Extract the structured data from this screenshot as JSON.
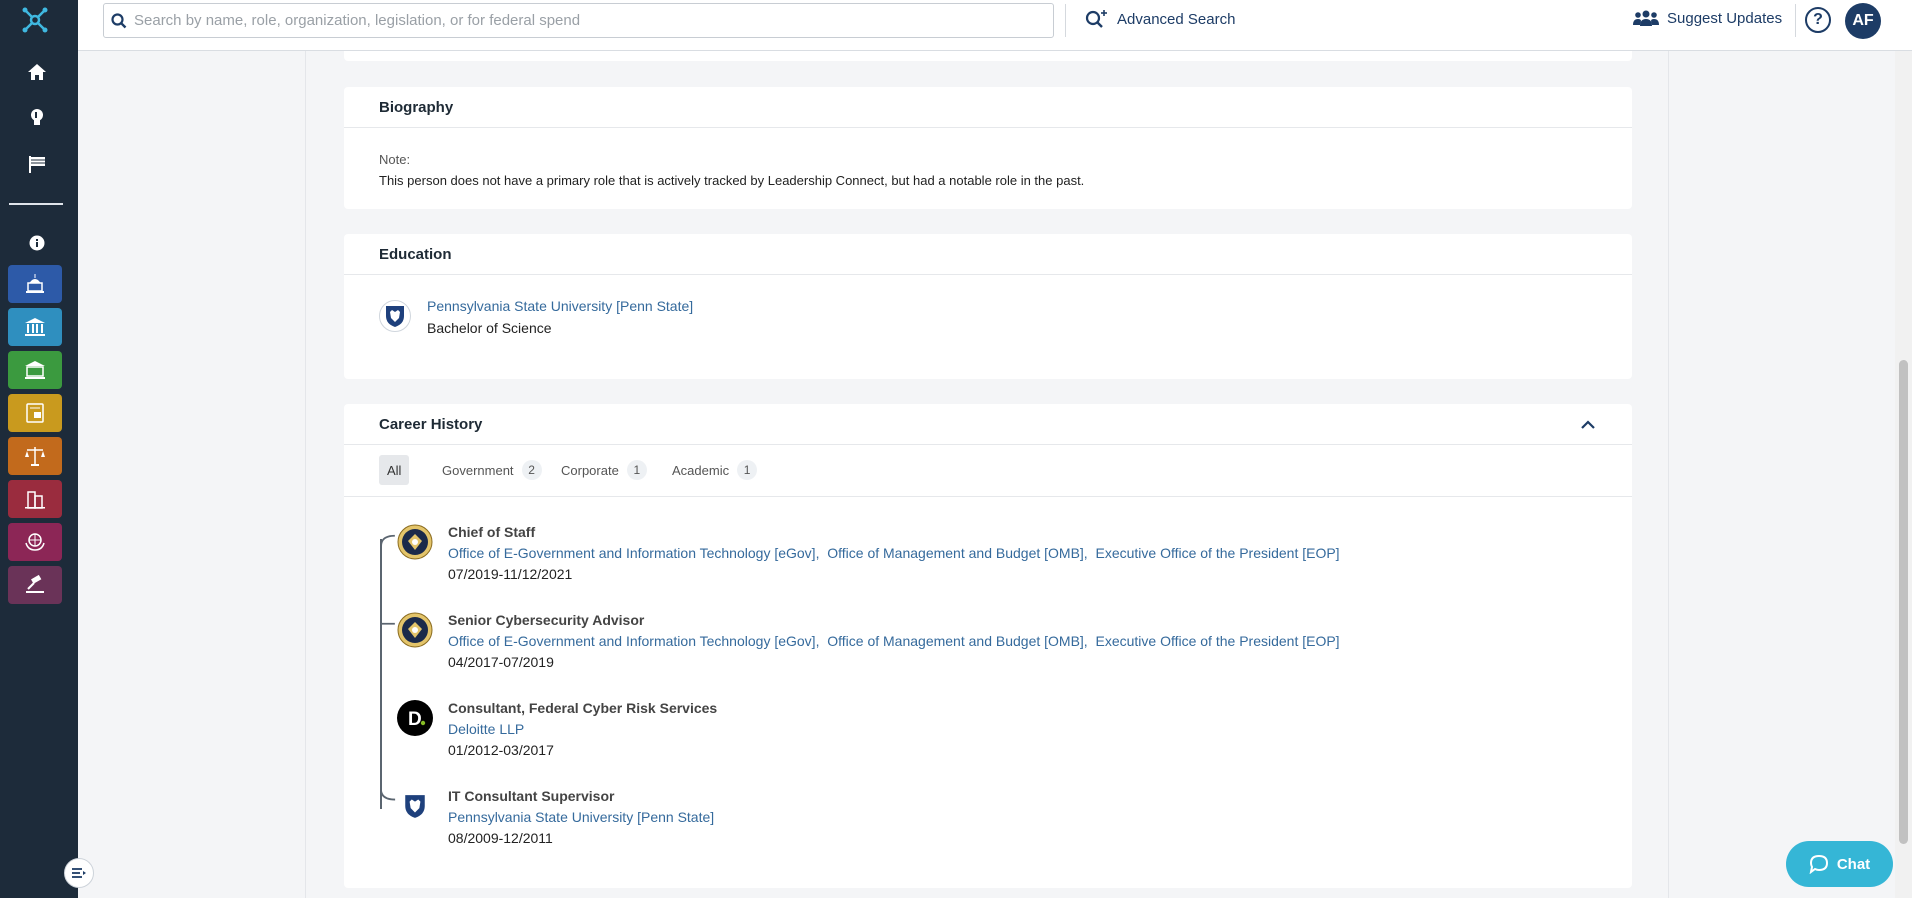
{
  "search": {
    "placeholder": "Search by name, role, organization, legislation, or for federal spend"
  },
  "topbar": {
    "advanced_search": "Advanced Search",
    "suggest_updates": "Suggest Updates",
    "help": "?",
    "avatar_initials": "AF"
  },
  "sidebar": {
    "icons": [
      "logo-icon",
      "home-icon",
      "lightbulb-icon",
      "flag-icon",
      "info-icon"
    ],
    "tiles": [
      {
        "name": "capitol-tile",
        "color": "#2d5aa8"
      },
      {
        "name": "federal-building-tile",
        "color": "#2f8fbf"
      },
      {
        "name": "state-building-tile",
        "color": "#3b9a3f"
      },
      {
        "name": "id-card-tile",
        "color": "#c99a1e"
      },
      {
        "name": "scales-tile",
        "color": "#c26a1c"
      },
      {
        "name": "city-tile",
        "color": "#9a2c3e"
      },
      {
        "name": "globe-hands-tile",
        "color": "#8c2656"
      },
      {
        "name": "gavel-tile",
        "color": "#6a3358"
      }
    ]
  },
  "biography": {
    "title": "Biography",
    "note_label": "Note:",
    "note_text": "This person does not have a primary role that is actively tracked by Leadership Connect, but had a notable role in the past."
  },
  "education": {
    "title": "Education",
    "items": [
      {
        "school": "Pennsylvania State University [Penn State]",
        "degree": "Bachelor of Science"
      }
    ]
  },
  "career": {
    "title": "Career History",
    "tabs": [
      {
        "label": "All",
        "count": ""
      },
      {
        "label": "Government",
        "count": "2"
      },
      {
        "label": "Corporate",
        "count": "1"
      },
      {
        "label": "Academic",
        "count": "1"
      }
    ],
    "jobs": [
      {
        "title": "Chief of Staff",
        "orgs": [
          "Office of E-Government and Information Technology [eGov],",
          "Office of Management and Budget [OMB],",
          "Executive Office of the President [EOP]"
        ],
        "dates": "07/2019-11/12/2021"
      },
      {
        "title": "Senior Cybersecurity Advisor",
        "orgs": [
          "Office of E-Government and Information Technology [eGov],",
          "Office of Management and Budget [OMB],",
          "Executive Office of the President [EOP]"
        ],
        "dates": "04/2017-07/2019"
      },
      {
        "title": "Consultant, Federal Cyber Risk Services",
        "orgs": [
          "Deloitte LLP"
        ],
        "dates": "01/2012-03/2017"
      },
      {
        "title": "IT Consultant Supervisor",
        "orgs": [
          "Pennsylvania State University [Penn State]"
        ],
        "dates": "08/2009-12/2011"
      }
    ]
  },
  "chat": {
    "label": "Chat"
  },
  "colors": {
    "brand": "#1d3c66",
    "link": "#356a9c",
    "sidebar": "#1d2b3a",
    "chat": "#35b6d6"
  }
}
